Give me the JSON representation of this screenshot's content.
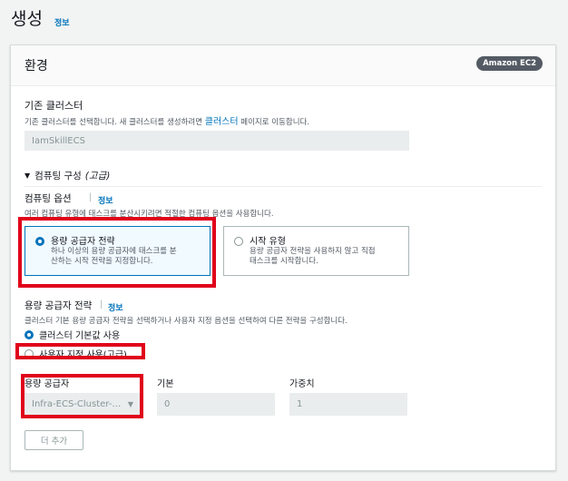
{
  "page": {
    "title": "생성",
    "info": "정보"
  },
  "panel": {
    "title": "환경",
    "badge": "Amazon EC2"
  },
  "existing_cluster": {
    "label": "기존 클러스터",
    "desc_before": "기존 클러스터를 선택합니다. 새 클러스터를 생성하려면 ",
    "desc_link": "클러스터",
    "desc_after": " 페이지로 이동합니다.",
    "value": "IamSkillECS"
  },
  "compute_config": {
    "toggle_label": "컴퓨팅 구성",
    "toggle_suffix": "(고급)"
  },
  "compute_options": {
    "label": "컴퓨팅 옵션",
    "separator": "|",
    "info": "정보",
    "desc": "여러 컴퓨팅 유형에 태스크를 분산시키려면 적절한 컴퓨팅 옵션을 사용합니다.",
    "tiles": [
      {
        "title": "용량 공급자 전략",
        "desc_line1": "하나 이상의 용량 공급자에 태스크를 분",
        "desc_line2": "산하는 시작 전략을 지정합니다.",
        "selected": true
      },
      {
        "title": "시작 유형",
        "desc_line1": "용량 공급자 전략을 사용하지 않고 직접",
        "desc_line2": "태스크를 시작합니다.",
        "selected": false
      }
    ]
  },
  "capacity_strategy": {
    "label": "용량 공급자 전략",
    "separator": "|",
    "info": "정보",
    "desc": "클러스터 기본 용량 공급자 전략을 선택하거나 사용자 지정 옵션을 선택하여 다른 전략을 구성합니다.",
    "options": [
      {
        "label": "클러스터 기본값 사용",
        "checked": true
      },
      {
        "label": "사용자 지정 사용(고급)",
        "checked": false
      }
    ]
  },
  "provider_table": {
    "col_provider": "용량 공급자",
    "col_base": "기본",
    "col_weight": "가중치",
    "provider_value": "Infra-ECS-Cluster-…",
    "base_value": "0",
    "weight_value": "1",
    "add_more": "더 추가"
  },
  "colors": {
    "accent": "#0073bb",
    "highlight_box": "#e0001b",
    "badge_bg": "#545b64"
  }
}
